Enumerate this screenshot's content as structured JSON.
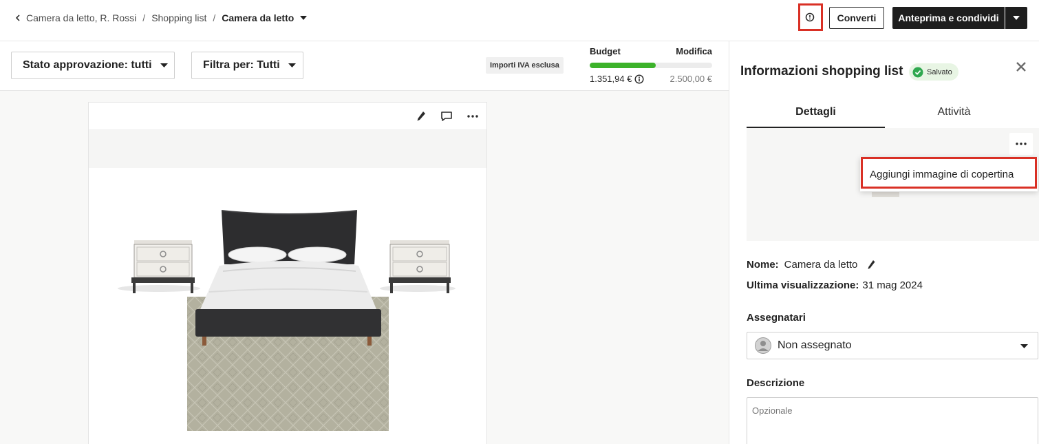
{
  "breadcrumb": {
    "items": [
      "Camera da letto, R. Rossi",
      "Shopping list"
    ],
    "separator": "/",
    "current": "Camera da letto"
  },
  "header": {
    "clock_icon": "clock-icon",
    "convert_label": "Converti",
    "share_label": "Anteprima e condividi"
  },
  "filters": {
    "approval": "Stato approvazione: tutti",
    "filter": "Filtra per: Tutti",
    "vat_note": "Importi IVA esclusa"
  },
  "budget": {
    "label": "Budget",
    "edit_label": "Modifica",
    "spent": "1.351,94 €",
    "total": "2.500,00 €",
    "progress_fraction": 0.54,
    "bar_color": "#3cb22a"
  },
  "board": {
    "tools": [
      "pencil-icon",
      "comment-icon",
      "more-icon"
    ],
    "image": "bedroom moodboard: black upholstered bed with white bedding, two white nightstands, beige patterned rug"
  },
  "panel": {
    "title": "Informazioni shopping list",
    "saved_label": "Salvato",
    "tabs": [
      {
        "label": "Dettagli",
        "active": true
      },
      {
        "label": "Attività",
        "active": false
      }
    ],
    "menu_item": "Aggiungi immagine di copertina",
    "name_label": "Nome:",
    "name_value": "Camera da letto",
    "last_view_label": "Ultima visualizzazione:",
    "last_view_value": "31 mag 2024",
    "assignees_label": "Assegnatari",
    "assignee_value": "Non assegnato",
    "description_label": "Descrizione",
    "description_placeholder": "Opzionale"
  },
  "colors": {
    "highlight": "#d93025",
    "primary_button": "#1e1e1e",
    "saved_badge_bg": "#e8f5e4",
    "saved_check": "#2fa84f"
  }
}
